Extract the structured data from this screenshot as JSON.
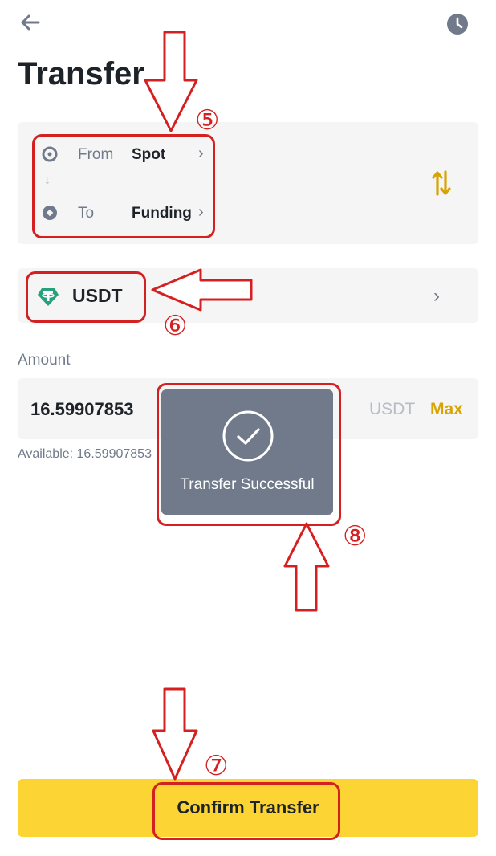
{
  "header": {
    "title": "Transfer",
    "back_icon": "arrow-left-icon",
    "history_icon": "clock-icon"
  },
  "account": {
    "from_label": "From",
    "from_value": "Spot",
    "to_label": "To",
    "to_value": "Funding",
    "down_arrow": "↓",
    "chevron": "›",
    "swap_icon": "swap-icon"
  },
  "coin": {
    "name": "USDT",
    "chevron": "›",
    "icon": "tether-icon"
  },
  "amount": {
    "label": "Amount",
    "value": "16.59907853",
    "unit": "USDT",
    "max_label": "Max",
    "available_text": "Available: 16.59907853"
  },
  "toast": {
    "text": "Transfer Successful",
    "icon": "check-circle-icon"
  },
  "footer": {
    "confirm_label": "Confirm Transfer"
  },
  "annotations": {
    "step5": "⑤",
    "step6": "⑥",
    "step7": "⑦",
    "step8": "⑧"
  },
  "colors": {
    "accent": "#fcd535",
    "annotation": "#d42020",
    "max": "#d9a400"
  }
}
